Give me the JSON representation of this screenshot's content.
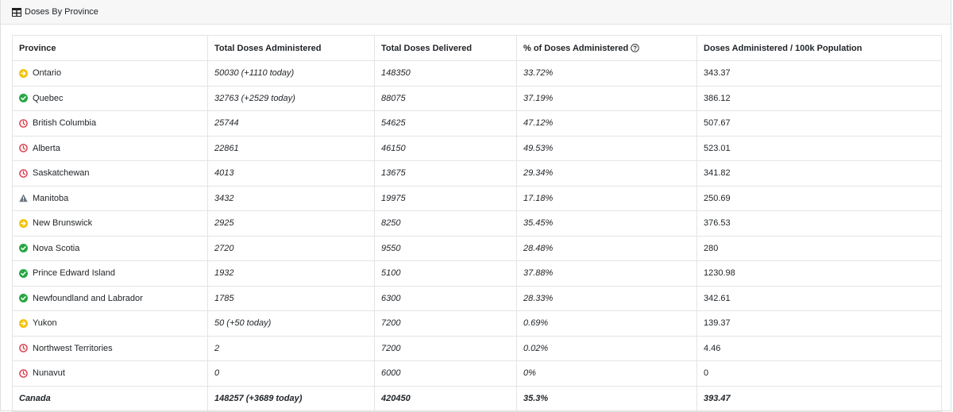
{
  "header": {
    "title": "Doses By Province"
  },
  "table": {
    "columns": [
      "Province",
      "Total Doses Administered",
      "Total Doses Delivered",
      "% of Doses Administered",
      "Doses Administered / 100k Population"
    ],
    "rows": [
      {
        "province": "Ontario",
        "status": "yellow-arrow-icon",
        "administered": "50030 (+1110 today)",
        "delivered": "148350",
        "pct": "33.72%",
        "per100k": "343.37"
      },
      {
        "province": "Quebec",
        "status": "green-check-icon",
        "administered": "32763 (+2529 today)",
        "delivered": "88075",
        "pct": "37.19%",
        "per100k": "386.12"
      },
      {
        "province": "British Columbia",
        "status": "red-clock-icon",
        "administered": "25744",
        "delivered": "54625",
        "pct": "47.12%",
        "per100k": "507.67"
      },
      {
        "province": "Alberta",
        "status": "red-clock-icon",
        "administered": "22861",
        "delivered": "46150",
        "pct": "49.53%",
        "per100k": "523.01"
      },
      {
        "province": "Saskatchewan",
        "status": "red-clock-icon",
        "administered": "4013",
        "delivered": "13675",
        "pct": "29.34%",
        "per100k": "341.82"
      },
      {
        "province": "Manitoba",
        "status": "gray-warning-icon",
        "administered": "3432",
        "delivered": "19975",
        "pct": "17.18%",
        "per100k": "250.69"
      },
      {
        "province": "New Brunswick",
        "status": "yellow-arrow-icon",
        "administered": "2925",
        "delivered": "8250",
        "pct": "35.45%",
        "per100k": "376.53"
      },
      {
        "province": "Nova Scotia",
        "status": "green-check-icon",
        "administered": "2720",
        "delivered": "9550",
        "pct": "28.48%",
        "per100k": "280"
      },
      {
        "province": "Prince Edward Island",
        "status": "green-check-icon",
        "administered": "1932",
        "delivered": "5100",
        "pct": "37.88%",
        "per100k": "1230.98"
      },
      {
        "province": "Newfoundland and Labrador",
        "status": "green-check-icon",
        "administered": "1785",
        "delivered": "6300",
        "pct": "28.33%",
        "per100k": "342.61"
      },
      {
        "province": "Yukon",
        "status": "yellow-arrow-icon",
        "administered": "50 (+50 today)",
        "delivered": "7200",
        "pct": "0.69%",
        "per100k": "139.37"
      },
      {
        "province": "Northwest Territories",
        "status": "red-clock-icon",
        "administered": "2",
        "delivered": "7200",
        "pct": "0.02%",
        "per100k": "4.46"
      },
      {
        "province": "Nunavut",
        "status": "red-clock-icon",
        "administered": "0",
        "delivered": "6000",
        "pct": "0%",
        "per100k": "0"
      }
    ],
    "total": {
      "province": "Canada",
      "administered": "148257 (+3689 today)",
      "delivered": "420450",
      "pct": "35.3%",
      "per100k": "393.47"
    }
  },
  "colors": {
    "green": "#28a745",
    "yellow": "#f4c20d",
    "red": "#dc3545",
    "gray": "#6c757d"
  }
}
